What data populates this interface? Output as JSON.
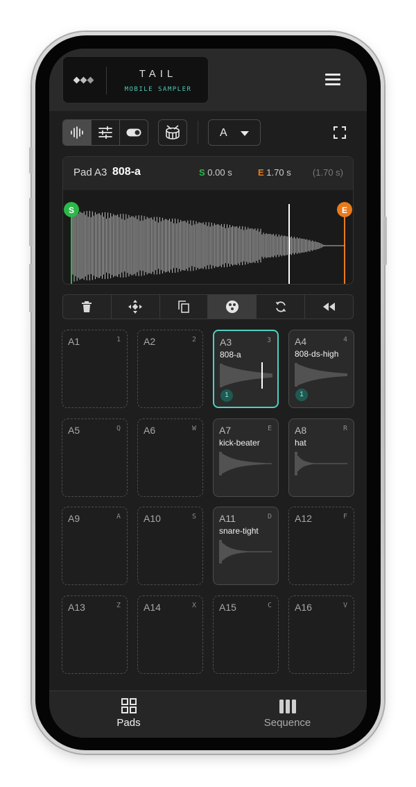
{
  "app": {
    "title": "TAIL",
    "subtitle": "MOBILE SAMPLER"
  },
  "toolbar": {
    "mode_buttons": [
      "waveform-icon",
      "sliders-icon",
      "toggle-icon"
    ],
    "active_mode": "waveform",
    "drum_icon": "drum-icon",
    "bank_value": "A"
  },
  "editor": {
    "pad_label": "Pad A3",
    "sample_name": "808-a",
    "start_prefix": "S",
    "start_value": "0.00 s",
    "end_prefix": "E",
    "end_value": "1.70 s",
    "duration": "(1.70 s)",
    "start_marker": "S",
    "end_marker": "E",
    "start_color": "#2bb84a",
    "end_color": "#e87a1c"
  },
  "actions": [
    {
      "name": "delete",
      "icon": "trash-icon"
    },
    {
      "name": "move",
      "icon": "move-icon"
    },
    {
      "name": "copy",
      "icon": "copy-icon"
    },
    {
      "name": "sample-pad",
      "icon": "sample-icon",
      "active": true
    },
    {
      "name": "loop",
      "icon": "loop-icon"
    },
    {
      "name": "rewind",
      "icon": "rewind-icon"
    }
  ],
  "pads": [
    {
      "id": "A1",
      "key": "1",
      "name": ""
    },
    {
      "id": "A2",
      "key": "2",
      "name": ""
    },
    {
      "id": "A3",
      "key": "3",
      "name": "808-a",
      "badge": "1",
      "selected": true
    },
    {
      "id": "A4",
      "key": "4",
      "name": "808-ds-high",
      "badge": "1"
    },
    {
      "id": "A5",
      "key": "Q",
      "name": ""
    },
    {
      "id": "A6",
      "key": "W",
      "name": ""
    },
    {
      "id": "A7",
      "key": "E",
      "name": "kick-beater"
    },
    {
      "id": "A8",
      "key": "R",
      "name": "hat"
    },
    {
      "id": "A9",
      "key": "A",
      "name": ""
    },
    {
      "id": "A10",
      "key": "S",
      "name": ""
    },
    {
      "id": "A11",
      "key": "D",
      "name": "snare-tight"
    },
    {
      "id": "A12",
      "key": "F",
      "name": ""
    },
    {
      "id": "A13",
      "key": "Z",
      "name": ""
    },
    {
      "id": "A14",
      "key": "X",
      "name": ""
    },
    {
      "id": "A15",
      "key": "C",
      "name": ""
    },
    {
      "id": "A16",
      "key": "V",
      "name": ""
    }
  ],
  "nav": {
    "pads_label": "Pads",
    "sequence_label": "Sequence",
    "active": "pads"
  },
  "colors": {
    "accent": "#4fd1c1",
    "subtitle": "#4fc9b4"
  }
}
